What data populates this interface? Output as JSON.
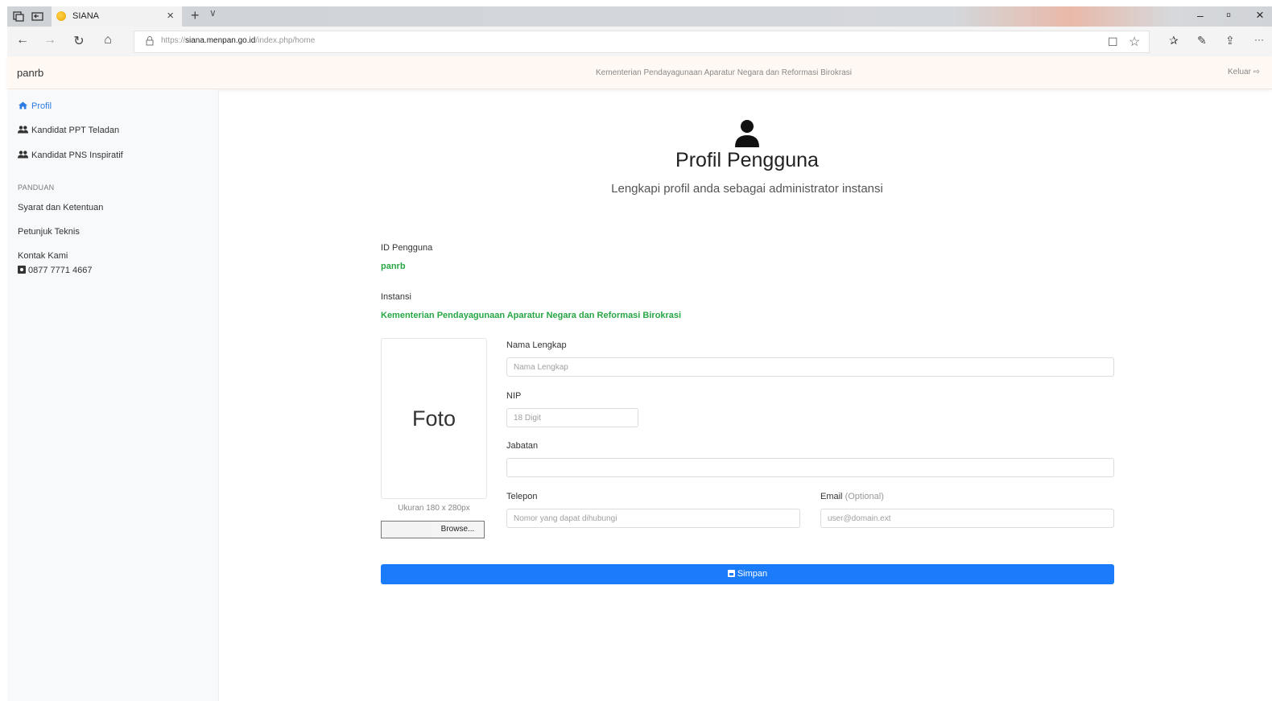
{
  "browser": {
    "tab_title": "SIANA",
    "tab_close": "×",
    "new_tab": "+",
    "tab_list": "∨",
    "window_minimize": "–",
    "window_restore": "▫",
    "window_close": "×",
    "back": "←",
    "forward": "→",
    "refresh": "↻",
    "home": "⌂",
    "url_scheme": "https://",
    "url_domain": "siana.menpan.go.id",
    "url_path": "/index.php/home",
    "reading_view": "☐",
    "favorite": "☆",
    "favorites_hub": "✰",
    "notes": "✎",
    "share": "⇪",
    "more": "···"
  },
  "navbar": {
    "brand": "panrb",
    "center_text": "Kementerian Pendayagunaan Aparatur Negara dan Reformasi Birokrasi",
    "logout": "Keluar ⇨"
  },
  "sidebar": {
    "items": [
      {
        "label": "Profil",
        "icon": "home-icon"
      },
      {
        "label": "Kandidat PPT Teladan",
        "icon": "users-icon"
      },
      {
        "label": "Kandidat PNS Inspiratif",
        "icon": "users-icon"
      }
    ],
    "section_heading": "PANDUAN",
    "links": [
      "Syarat dan Ketentuan",
      "Petunjuk Teknis"
    ],
    "contact_label": "Kontak Kami",
    "contact_phone": "0877 7771 4667"
  },
  "header": {
    "title": "Profil Pengguna",
    "subtitle": "Lengkapi profil anda sebagai administrator instansi"
  },
  "profile": {
    "id_label": "ID Pengguna",
    "id_value": "panrb",
    "instansi_label": "Instansi",
    "instansi_value": "Kementerian Pendayagunaan Aparatur Negara dan Reformasi Birokrasi"
  },
  "photo": {
    "placeholder_text": "Foto",
    "size_hint": "Ukuran 180 x 280px",
    "browse_label": "Browse..."
  },
  "form": {
    "nama": {
      "label": "Nama Lengkap",
      "placeholder": "Nama Lengkap",
      "value": ""
    },
    "nip": {
      "label": "NIP",
      "placeholder": "18 Digit",
      "value": ""
    },
    "jabatan": {
      "label": "Jabatan",
      "placeholder": "",
      "value": ""
    },
    "telepon": {
      "label": "Telepon",
      "placeholder": "Nomor yang dapat dihubungi",
      "value": ""
    },
    "email": {
      "label": "Email",
      "label_note": "(Optional)",
      "placeholder": "user@domain.ext",
      "value": ""
    },
    "save_label": "Simpan"
  },
  "colors": {
    "accent_blue": "#1a7cfb",
    "success_green": "#28a745",
    "sidebar_active": "#2b7be4",
    "navbar_bg": "#fff8f3"
  }
}
